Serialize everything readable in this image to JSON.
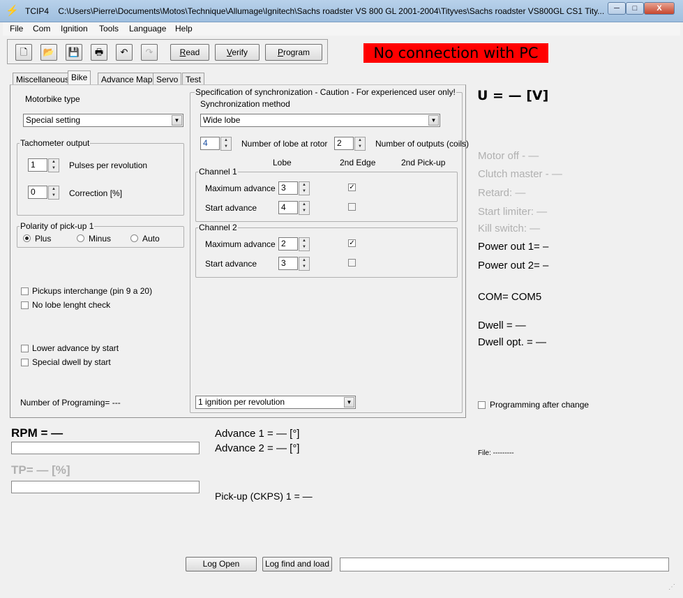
{
  "window": {
    "app": "TCIP4",
    "path": "C:\\Users\\Pierre\\Documents\\Motos\\Technique\\Allumage\\Ignitech\\Sachs roadster VS 800 GL 2001-2004\\Tityves\\Sachs roadster VS800GL CS1 Tity...",
    "minimize": "─",
    "maximize": "□",
    "close": "X"
  },
  "menu": [
    "File",
    "Com",
    "Ignition",
    "Tools",
    "Language",
    "Help"
  ],
  "toolbar": {
    "read": "Read",
    "verify": "Verify",
    "program": "Program",
    "read_u": "R",
    "read_rest": "ead",
    "verify_u": "V",
    "verify_rest": "erify",
    "program_u": "P",
    "program_rest": "rogram"
  },
  "status_banner": "No connection with PC",
  "tabs": [
    "Miscellaneous",
    "Bike",
    "Advance Map",
    "Servo",
    "Test"
  ],
  "bike": {
    "motorbike_type_label": "Motorbike type",
    "motorbike_type_value": "Special setting",
    "tacho_group": "Tachometer output",
    "pulses_value": "1",
    "pulses_label": "Pulses per revolution",
    "correction_value": "0",
    "correction_label": "Correction [%]",
    "polarity_group": "Polarity of pick-up 1",
    "polarity_options": [
      "Plus",
      "Minus",
      "Auto"
    ],
    "checks": [
      "Pickups interchange (pin 9 a 20)",
      "No lobe lenght check",
      "Lower advance by start",
      "Special dwell by start"
    ],
    "num_programing": "Number of Programing= ---"
  },
  "sync": {
    "group": "Specification of synchronization - Caution - For experienced user only!",
    "method_label": "Synchronization method",
    "method_value": "Wide lobe",
    "lobe_count": "4",
    "lobe_count_label": "Number of lobe at rotor",
    "outputs_count": "2",
    "outputs_label": "Number of outputs (coils)",
    "col_lobe": "Lobe",
    "col_edge": "2nd Edge",
    "col_pickup": "2nd Pick-up",
    "channel1": {
      "title": "Channel 1",
      "max_label": "Maximum advance",
      "max_val": "3",
      "start_label": "Start advance",
      "start_val": "4"
    },
    "channel2": {
      "title": "Channel 2",
      "max_label": "Maximum advance",
      "max_val": "2",
      "start_label": "Start advance",
      "start_val": "3"
    },
    "ignition_select": "1 ignition per revolution"
  },
  "right": {
    "voltage": "U = — [V]",
    "motor_off": "Motor off - —",
    "clutch": "Clutch master - —",
    "retard": "Retard: —",
    "start_limiter": "Start limiter: —",
    "kill_switch": "Kill switch: —",
    "power1": "Power out 1= –",
    "power2": "Power out 2= –",
    "com": "COM= COM5",
    "dwell": "Dwell = —",
    "dwell_opt": "Dwell opt. = —",
    "prog_after": "Programming after change",
    "file": "File:  ---------"
  },
  "bottom": {
    "rpm": "RPM = —",
    "tp": "TP= — [%]",
    "advance1": "Advance 1 = — [°]",
    "advance2": "Advance 2 = — [°]",
    "pickup": "Pick-up (CKPS) 1 = —",
    "log_open": "Log Open",
    "log_find": "Log find and load"
  },
  "colors": {
    "banner": "#ff0000",
    "disabled": "#b0b0b0"
  }
}
